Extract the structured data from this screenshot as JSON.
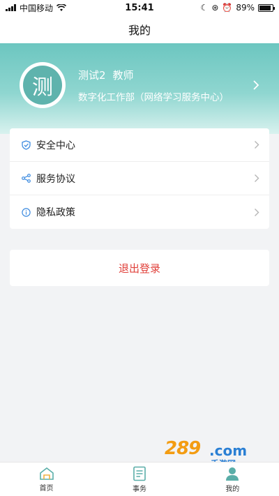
{
  "status_bar": {
    "carrier": "中国移动",
    "time": "15:41",
    "battery": "89%",
    "battery_level": 0.89
  },
  "nav": {
    "title": "我的"
  },
  "profile": {
    "avatar_char": "测",
    "name": "测试2",
    "role": "教师",
    "department": "数字化工作部（网络学习服务中心）"
  },
  "menu": {
    "items": [
      {
        "label": "安全中心",
        "icon": "shield-icon"
      },
      {
        "label": "服务协议",
        "icon": "share-icon"
      },
      {
        "label": "隐私政策",
        "icon": "info-icon"
      }
    ]
  },
  "logout": {
    "label": "退出登录"
  },
  "tabs": [
    {
      "label": "首页",
      "icon": "home-icon"
    },
    {
      "label": "事务",
      "icon": "document-icon"
    },
    {
      "label": "我的",
      "icon": "person-icon"
    }
  ],
  "watermark": {
    "text": "289",
    "domain": ".com",
    "sub": "手游网"
  },
  "colors": {
    "accent": "#6cc6c0",
    "logout": "#e0403a",
    "icon_blue": "#3d8be0"
  }
}
